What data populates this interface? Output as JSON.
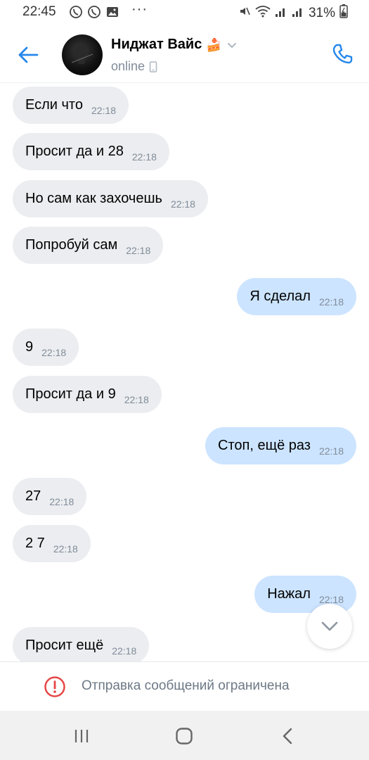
{
  "status_bar": {
    "time": "22:45",
    "battery": "31%",
    "left_icons": [
      "viber-icon",
      "viber-icon",
      "gallery-icon"
    ],
    "more": "···"
  },
  "header": {
    "contact_name": "Ниджат Вайс",
    "name_emoji": "🍰",
    "status": "online",
    "accent_color": "#2688eb"
  },
  "messages": [
    {
      "dir": "in",
      "text": "Если что",
      "time": "22:18"
    },
    {
      "dir": "in",
      "text": "Просит да и 28",
      "time": "22:18"
    },
    {
      "dir": "in",
      "text": "Но сам как захочешь",
      "time": "22:18"
    },
    {
      "dir": "in",
      "text": "Попробуй сам",
      "time": "22:18"
    },
    {
      "dir": "out",
      "text": "Я сделал",
      "time": "22:18"
    },
    {
      "dir": "in",
      "text": "9",
      "time": "22:18"
    },
    {
      "dir": "in",
      "text": "Просит да и 9",
      "time": "22:18"
    },
    {
      "dir": "out",
      "text": "Стоп, ещё раз",
      "time": "22:18"
    },
    {
      "dir": "in",
      "text": "27",
      "time": "22:18"
    },
    {
      "dir": "in",
      "text": "2 7",
      "time": "22:18"
    },
    {
      "dir": "out",
      "text": "Нажал",
      "time": "22:18"
    },
    {
      "dir": "in",
      "text": "Просит ещё",
      "time": "22:18"
    }
  ],
  "restriction": {
    "text": "Отправка сообщений ограничена",
    "icon_color": "#e64646"
  },
  "colors": {
    "incoming_bubble": "#ebedf0",
    "outgoing_bubble": "#cce4ff"
  }
}
